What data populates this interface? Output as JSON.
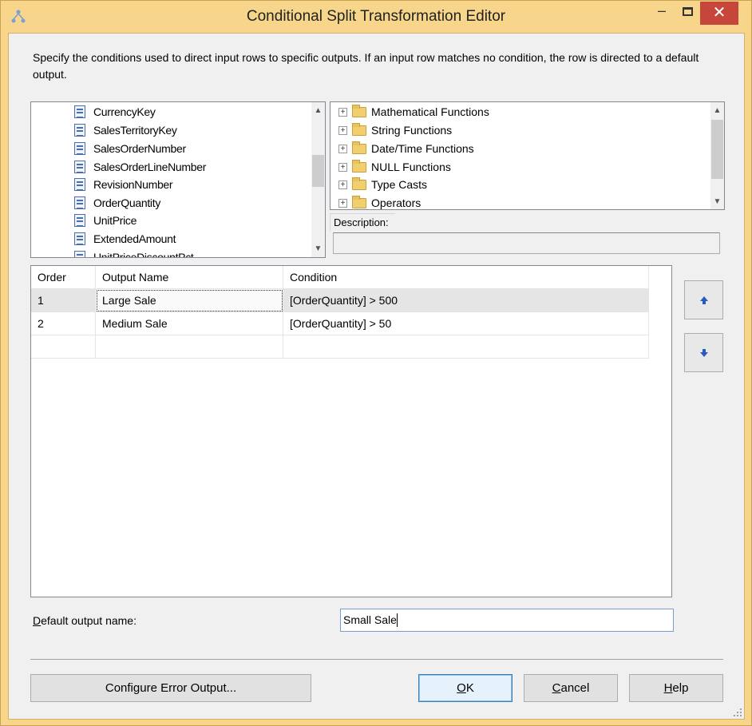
{
  "window": {
    "title": "Conditional Split Transformation Editor",
    "minimize": "–",
    "close": "✕"
  },
  "intro": "Specify the conditions used to direct input rows to specific outputs. If an input row matches no condition, the row is directed to a default output.",
  "columns": [
    "CurrencyKey",
    "SalesTerritoryKey",
    "SalesOrderNumber",
    "SalesOrderLineNumber",
    "RevisionNumber",
    "OrderQuantity",
    "UnitPrice",
    "ExtendedAmount",
    "UnitPriceDiscountPct"
  ],
  "functions": [
    "Mathematical Functions",
    "String Functions",
    "Date/Time Functions",
    "NULL Functions",
    "Type Casts",
    "Operators"
  ],
  "description_label": "Description:",
  "description_value": "",
  "grid": {
    "headers": {
      "order": "Order",
      "output_name": "Output Name",
      "condition": "Condition"
    },
    "rows": [
      {
        "order": "1",
        "output_name": "Large Sale",
        "condition": "[OrderQuantity] > 500"
      },
      {
        "order": "2",
        "output_name": "Medium Sale",
        "condition": "[OrderQuantity] > 50"
      }
    ]
  },
  "move_up_icon": "arrow-up-icon",
  "move_down_icon": "arrow-down-icon",
  "default_output": {
    "label_first": "D",
    "label_rest": "efault output name:",
    "value": "Small Sale"
  },
  "buttons": {
    "configure_error": "Configure Error Output...",
    "ok_u": "O",
    "ok_rest": "K",
    "cancel_u": "C",
    "cancel_rest": "ancel",
    "help_u": "H",
    "help_rest": "elp"
  },
  "colors": {
    "frame": "#f7d58a",
    "close_button": "#c7463b",
    "client": "#f0f0f0"
  }
}
